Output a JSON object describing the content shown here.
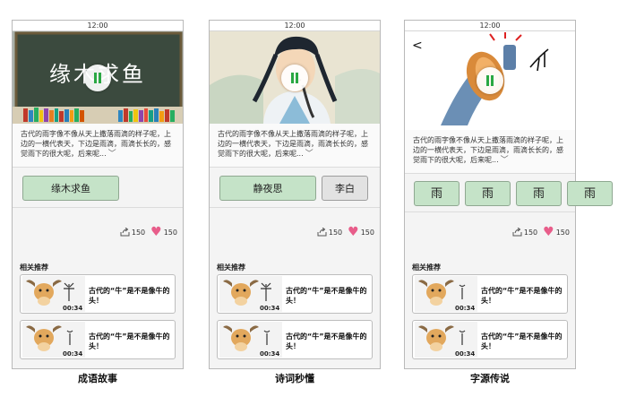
{
  "screens": [
    {
      "status_time": "12:00",
      "media_title": "缘木求鱼",
      "description": "古代的雨字像不像从天上撒落雨滴的样子呢，上边的一横代表天，下边是雨滴，雨滴长长的，感觉雨下的很大呢，后来呢...",
      "options": [
        "缘木求鱼"
      ],
      "share_count": "150",
      "like_count": "150",
      "related_title": "相关推荐",
      "related": [
        {
          "title": "古代的“牛”是不是像牛的头！",
          "duration": "00:34"
        },
        {
          "title": "古代的“牛”是不是像牛的头！",
          "duration": "00:34"
        }
      ],
      "caption": "成语故事"
    },
    {
      "status_time": "12:00",
      "description": "古代的雨字像不像从天上撒落雨滴的样子呢，上边的一横代表天，下边是雨滴，雨滴长长的，感觉雨下的很大呢，后来呢...",
      "options": [
        "静夜思",
        "李白"
      ],
      "share_count": "150",
      "like_count": "150",
      "related_title": "相关推荐",
      "related": [
        {
          "title": "古代的“牛”是不是像牛的头！",
          "duration": "00:34"
        },
        {
          "title": "古代的“牛”是不是像牛的头！",
          "duration": "00:34"
        }
      ],
      "caption": "诗词秒懂"
    },
    {
      "status_time": "12:00",
      "back_icon": "<",
      "description": "古代的雨字像不像从天上撒落雨滴的样子呢，上边的一横代表天，下边是雨滴，雨滴长长的，感觉雨下的很大呢，后来呢...",
      "options": [
        "雨",
        "雨",
        "雨",
        "雨"
      ],
      "share_count": "150",
      "like_count": "150",
      "related_title": "相关推荐",
      "related": [
        {
          "title": "古代的“牛”是不是像牛的头！",
          "duration": "00:34"
        },
        {
          "title": "古代的“牛”是不是像牛的头！",
          "duration": "00:34"
        }
      ],
      "caption": "字源传说"
    }
  ],
  "icons": {
    "share": "share-icon",
    "like": "heart-icon",
    "play": "pause-icon",
    "expand": "chevron-down-icon"
  },
  "colors": {
    "accent_green": "#c5e3c8",
    "heart": "#e85d8a",
    "play_bars": "#2aa843"
  }
}
